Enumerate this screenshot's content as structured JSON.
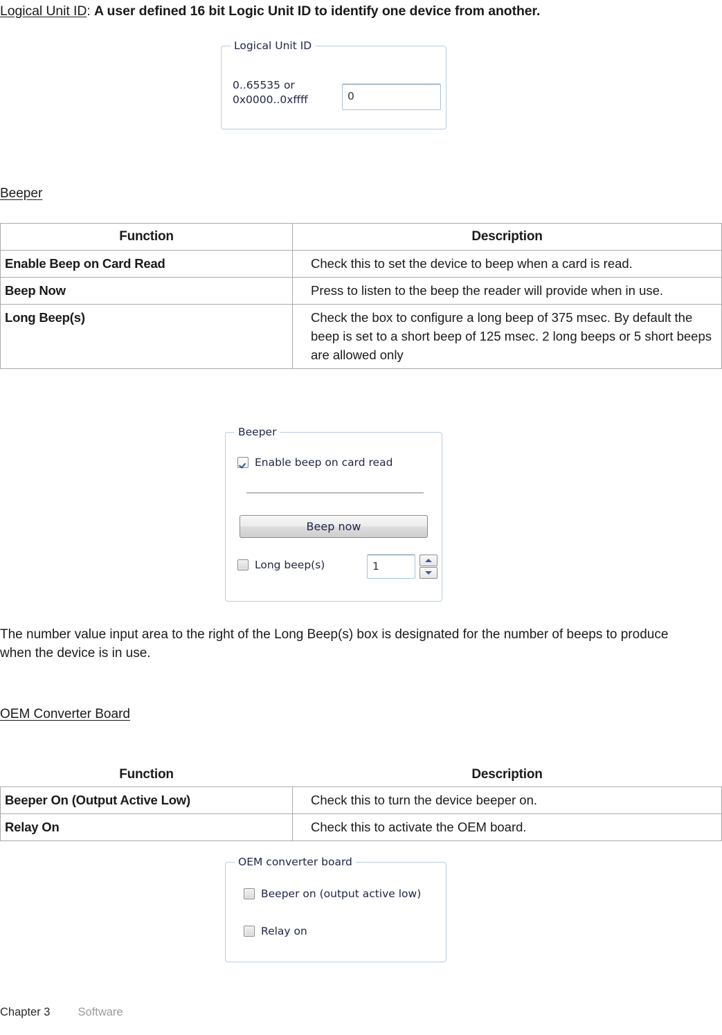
{
  "intro": {
    "term": "Logical Unit ID",
    "separator": ": ",
    "rest": "A user defined 16 bit Logic Unit ID to identify one device from another."
  },
  "logical_unit_box": {
    "legend": "Logical Unit ID",
    "range_line1": "0..65535 or",
    "range_line2": "0x0000..0xffff",
    "input_value": "0",
    "input_placeholder": "",
    "border_color": "#b7cde4"
  },
  "beeper_section": {
    "heading": "Beeper",
    "table": {
      "headers": [
        "Function",
        "Description"
      ],
      "rows": [
        {
          "function": "Enable Beep on Card Read",
          "description": "Check this to set the device to beep when a card is read."
        },
        {
          "function": "Beep Now",
          "description": "Press to listen to the beep the reader will provide when in use."
        },
        {
          "function": "Long Beep(s)",
          "description": "Check the box to configure a long beep of 375 msec. By default the beep is set to a short beep of 125 msec. 2 long beeps or 5 short beeps are allowed only"
        }
      ]
    },
    "dialog": {
      "legend": "Beeper",
      "enable_checkbox_label": "Enable beep on card read",
      "enable_checkbox_checked": true,
      "beep_now_button": "Beep now",
      "long_beep_label": "Long beep(s)",
      "long_beep_checked": false,
      "spinner_value": "1",
      "spin_up_icon": "triangle-up-icon",
      "spin_down_icon": "triangle-down-icon"
    },
    "paragraph": "The number value input area to the right of the Long Beep(s) box is designated for the number of beeps to produce when the device is in use."
  },
  "oem_section": {
    "heading": "OEM Converter Board",
    "table": {
      "headers": [
        "Function",
        "Description"
      ],
      "rows": [
        {
          "function": "Beeper On (Output Active Low)",
          "description": "Check this to turn the device beeper on."
        },
        {
          "function": "Relay On",
          "description": "Check this to activate the OEM board."
        }
      ]
    },
    "dialog": {
      "legend": "OEM converter board",
      "beeper_on_label": "Beeper on (output active low)",
      "beeper_on_checked": false,
      "relay_on_label": "Relay on",
      "relay_on_checked": false
    }
  },
  "footer": {
    "chapter": "Chapter 3",
    "section": "Software"
  }
}
